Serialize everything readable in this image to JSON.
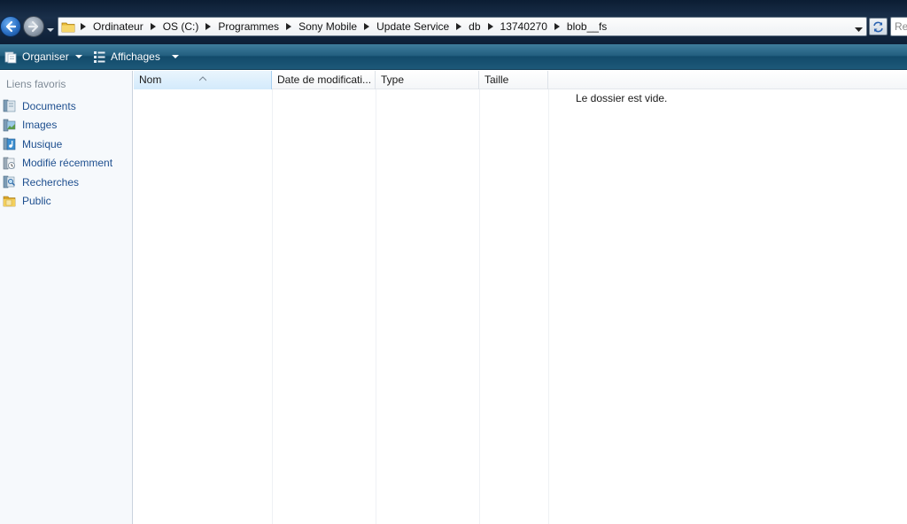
{
  "address": {
    "breadcrumbs": [
      "Ordinateur",
      "OS (C:)",
      "Programmes",
      "Sony Mobile",
      "Update Service",
      "db",
      "13740270",
      "blob__fs"
    ],
    "search_placeholder": "Re"
  },
  "toolbar": {
    "organiser_label": "Organiser",
    "affichages_label": "Affichages"
  },
  "navigation": {
    "title": "Liens favoris",
    "links": [
      {
        "label": "Documents",
        "icon": "documents-icon"
      },
      {
        "label": "Images",
        "icon": "images-icon"
      },
      {
        "label": "Musique",
        "icon": "music-icon"
      },
      {
        "label": "Modifié récemment",
        "icon": "recent-icon"
      },
      {
        "label": "Recherches",
        "icon": "search-folder-icon"
      },
      {
        "label": "Public",
        "icon": "public-folder-icon"
      }
    ]
  },
  "filelist": {
    "columns": [
      "Nom",
      "Date de modificati...",
      "Type",
      "Taille"
    ],
    "sorted_column": "Nom",
    "empty_message": "Le dossier est vide."
  },
  "colors": {
    "link": "#1e4f8f",
    "command_bar": "#235f80",
    "nav_back": "#2a6fc3"
  }
}
